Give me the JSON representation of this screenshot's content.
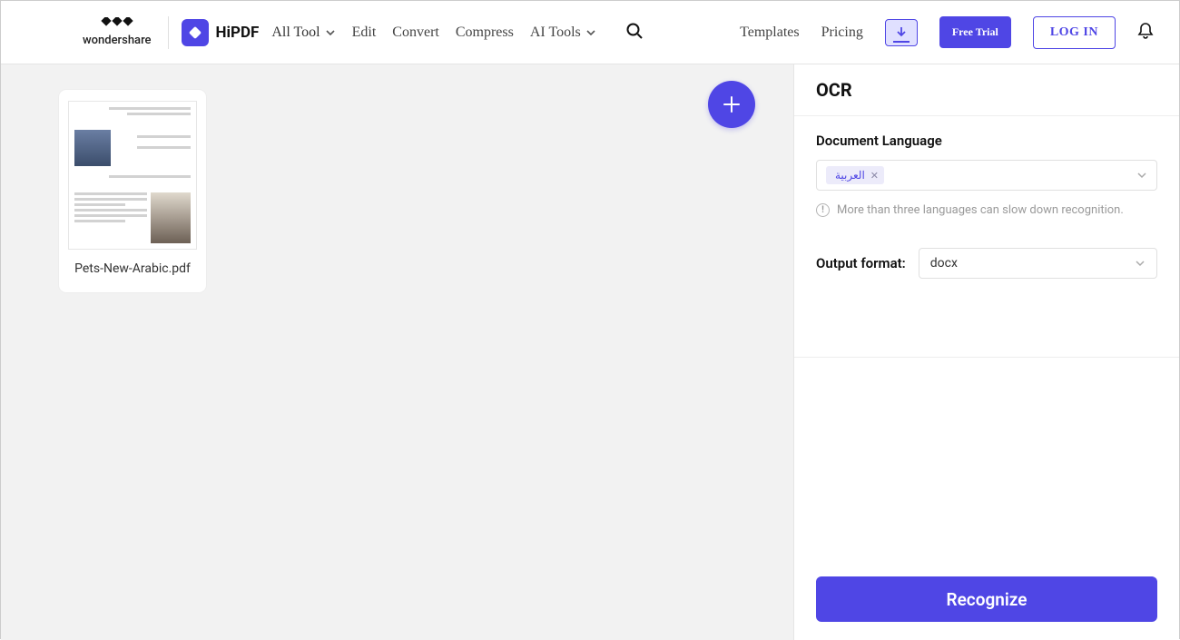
{
  "brand": {
    "wondershare": "wondershare",
    "hipdf": "HiPDF"
  },
  "nav": {
    "all_tool": "All Tool",
    "edit": "Edit",
    "convert": "Convert",
    "compress": "Compress",
    "ai_tools": "AI Tools"
  },
  "right_nav": {
    "templates": "Templates",
    "pricing": "Pricing",
    "free_trial": "Free Trial",
    "login": "LOG IN"
  },
  "file": {
    "name": "Pets-New-Arabic.pdf"
  },
  "panel": {
    "title": "OCR",
    "language_label": "Document Language",
    "language_tag": "العربية",
    "hint": "More than three languages can slow down recognition.",
    "output_label": "Output format:",
    "output_value": "docx",
    "recognize": "Recognize"
  }
}
